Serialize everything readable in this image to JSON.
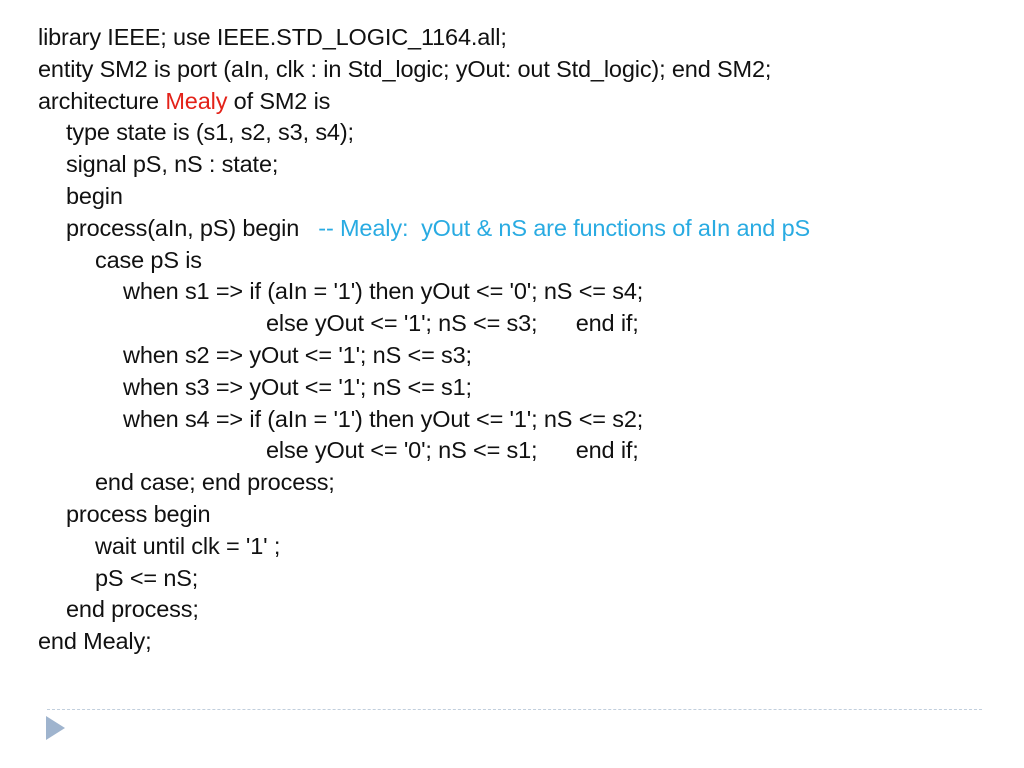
{
  "slide": {
    "background_color": "#ffffff",
    "text_color": "#111111",
    "accent_red": "#e32219",
    "accent_cyan": "#29abe2",
    "divider_color": "#c2cfdd",
    "arrow_color": "#9fb4ce"
  },
  "code": {
    "line_01": "library IEEE; use IEEE.STD_LOGIC_1164.all;",
    "line_02": "entity SM2 is port (aIn, clk : in Std_logic; yOut: out Std_logic); end SM2;",
    "line_03_a": "architecture ",
    "line_03_b": "Mealy",
    "line_03_c": " of SM2 is",
    "line_04": "type state is (s1, s2, s3, s4);",
    "line_05": "signal pS, nS : state;",
    "line_06": "begin",
    "line_07_a": "process(aIn, pS) begin   ",
    "line_07_b": "-- Mealy:  yOut & nS are functions of aIn and pS",
    "line_08": "case pS is",
    "line_09": "when s1 => if (aIn = '1') then yOut <= '0'; nS <= s4;",
    "line_10": "else yOut <= '1'; nS <= s3;      end if;",
    "line_11": "when s2 => yOut <= '1'; nS <= s3;",
    "line_12": "when s3 => yOut <= '1'; nS <= s1;",
    "line_13": "when s4 => if (aIn = '1') then yOut <= '1'; nS <= s2;",
    "line_14": "else yOut <= '0'; nS <= s1;      end if;",
    "line_15": "end case; end process;",
    "line_16": "process begin",
    "line_17": "wait until clk = '1' ;",
    "line_18": "pS <= nS;",
    "line_19": "end process;",
    "line_20": "end Mealy;"
  },
  "footer": {
    "advance_icon": "play-triangle-icon"
  }
}
